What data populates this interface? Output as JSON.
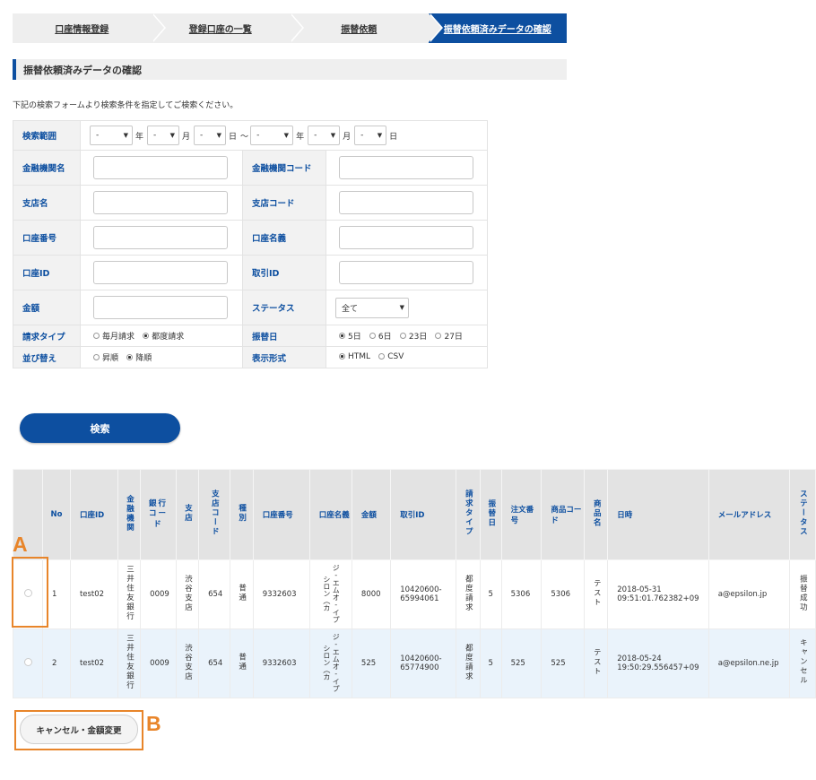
{
  "steps": [
    {
      "label": "口座情報登録",
      "active": false
    },
    {
      "label": "登録口座の一覧",
      "active": false
    },
    {
      "label": "振替依頼",
      "active": false
    },
    {
      "label": "振替依頼済みデータの確認",
      "active": true
    }
  ],
  "section_title": "振替依頼済みデータの確認",
  "instruction": "下記の検索フォームより検索条件を指定してご検索ください。",
  "form": {
    "range_label": "検索範囲",
    "range": {
      "from_year": "-",
      "year_unit": "年",
      "from_month": "-",
      "month_unit": "月",
      "from_day": "-",
      "day_unit": "日",
      "tilde": "～",
      "to_year": "-",
      "to_month": "-",
      "to_day": "-"
    },
    "bank_name_label": "金融機関名",
    "bank_code_label": "金融機関コード",
    "branch_name_label": "支店名",
    "branch_code_label": "支店コード",
    "account_number_label": "口座番号",
    "account_holder_label": "口座名義",
    "account_id_label": "口座ID",
    "transaction_id_label": "取引ID",
    "amount_label": "金額",
    "status_label": "ステータス",
    "status_value": "全て",
    "billing_type_label": "請求タイプ",
    "billing_type_options": [
      "毎月請求",
      "都度請求"
    ],
    "transfer_day_label": "振替日",
    "transfer_day_options": [
      "5日",
      "6日",
      "23日",
      "27日"
    ],
    "sort_label": "並び替え",
    "sort_options": [
      "昇順",
      "降順"
    ],
    "format_label": "表示形式",
    "format_options": [
      "HTML",
      "CSV"
    ]
  },
  "search_button": "検索",
  "results": {
    "headers": [
      "No",
      "口座ID",
      "金融機関",
      "銀行コード",
      "支店",
      "支店コード",
      "種別",
      "口座番号",
      "口座名義",
      "金額",
      "取引ID",
      "請求タイプ",
      "振替日",
      "注文番号",
      "商品コード",
      "商品名",
      "日時",
      "メールアドレス",
      "ステータス"
    ],
    "rows": [
      {
        "no": "1",
        "account_id": "test02",
        "bank": "三井住友銀行",
        "bank_code": "0009",
        "branch": "渋谷支店",
        "branch_code": "654",
        "type": "普通",
        "account_number": "9332603",
        "holder": "ジ-エムオ-イプシロン（カ",
        "amount": "8000",
        "transaction_id_1": "10420600-",
        "transaction_id_2": "65994061",
        "billing_type": "都度請求",
        "transfer_day": "5",
        "order_no": "5306",
        "product_code": "5306",
        "product_name": "テスト",
        "datetime_1": "2018-05-31",
        "datetime_2": "09:51:01.762382+09",
        "email": "a@epsilon.jp",
        "status": "振替成功"
      },
      {
        "no": "2",
        "account_id": "test02",
        "bank": "三井住友銀行",
        "bank_code": "0009",
        "branch": "渋谷支店",
        "branch_code": "654",
        "type": "普通",
        "account_number": "9332603",
        "holder": "ジ-エムオ-イプシロン（カ",
        "amount": "525",
        "transaction_id_1": "10420600-",
        "transaction_id_2": "65774900",
        "billing_type": "都度請求",
        "transfer_day": "5",
        "order_no": "525",
        "product_code": "525",
        "product_name": "テスト",
        "datetime_1": "2018-05-24",
        "datetime_2": "19:50:29.556457+09",
        "email": "a@epsilon.ne.jp",
        "status": "キャンセル"
      }
    ]
  },
  "cancel_button": "キャンセル・金額変更",
  "annotations": {
    "a": "A",
    "b": "B"
  },
  "colors": {
    "primary": "#0d4fa0",
    "highlight": "#e8852a",
    "row_alt": "#eaf3fb"
  }
}
